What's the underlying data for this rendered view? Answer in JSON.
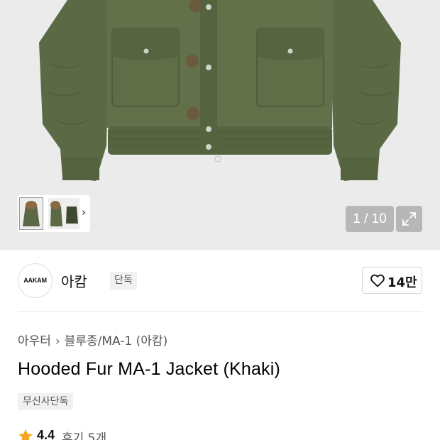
{
  "gallery": {
    "counter": "1 / 10",
    "thumbnail_icons": [
      "jacket-thumbnail-front",
      "jacket-thumbnail-side",
      "jacket-thumbnail-back"
    ],
    "next_icon": "chevron-right-icon",
    "expand_icon": "expand-icon"
  },
  "brand": {
    "logo_text": "AAKAM",
    "name": "아캄",
    "badge": "단독",
    "like_count": "14만",
    "like_icon": "heart-icon"
  },
  "breadcrumb": {
    "category": "아우터",
    "sub": "블루종/MA-1 (아캄)"
  },
  "product": {
    "title": "Hooded Fur MA-1 Jacket (Khaki)",
    "tag": "무신사단독",
    "rating": "4.4",
    "review_label": "후기 5개"
  },
  "colors": {
    "accent_star": "#f5a623",
    "jacket_khaki": "#5b6a45"
  }
}
